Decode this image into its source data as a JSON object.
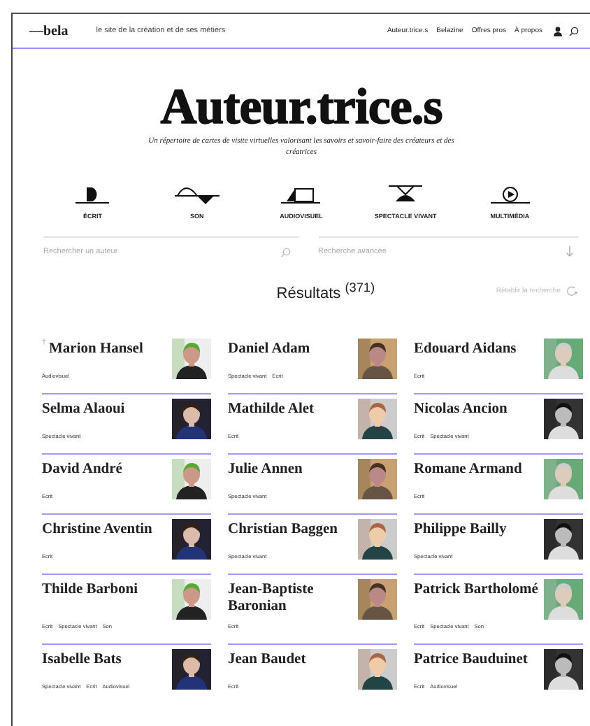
{
  "header": {
    "logo": "—bela",
    "tagline": "le site de la création et de ses métiers",
    "nav": [
      "Auteur.trice.s",
      "Belazine",
      "Offres pros",
      "À propos"
    ]
  },
  "title": "Auteur.trice.s",
  "subtitle": "Un répertoire de cartes de visite virtuelles valorisant les savoirs et savoir-faire des créateurs et des créatrices",
  "categories": [
    {
      "kind": "ecrit",
      "label": "ÉCRIT"
    },
    {
      "kind": "son",
      "label": "SON"
    },
    {
      "kind": "audiovisuel",
      "label": "AUDIOVISUEL"
    },
    {
      "kind": "spectacle",
      "label": "SPECTACLE VIVANT"
    },
    {
      "kind": "multimedia",
      "label": "MULTIMÉDIA"
    }
  ],
  "search": {
    "placeholder": "Rechercher un auteur"
  },
  "advanced": {
    "label": "Recherche avancée"
  },
  "results": {
    "label": "Résultats",
    "count": "(371)",
    "reset": "Rétablir la recherche"
  },
  "authors": [
    {
      "mark": "†",
      "name": "Marion Hansel",
      "tags": [
        "Audiovisuel"
      ]
    },
    {
      "name": "Daniel Adam",
      "tags": [
        "Spectacle vivant",
        "Ecrit"
      ]
    },
    {
      "name": "Edouard Aidans",
      "tags": [
        "Ecrit"
      ]
    },
    {
      "name": "Selma Alaoui",
      "tags": [
        "Spectacle vivant"
      ]
    },
    {
      "name": "Mathilde Alet",
      "tags": [
        "Ecrit"
      ]
    },
    {
      "name": "Nicolas Ancion",
      "tags": [
        "Ecrit",
        "Spectacle vivant"
      ]
    },
    {
      "name": "David André",
      "tags": [
        "Ecrit"
      ]
    },
    {
      "name": "Julie Annen",
      "tags": [
        "Spectacle vivant"
      ]
    },
    {
      "name": "Romane Armand",
      "tags": [
        "Ecrit"
      ]
    },
    {
      "name": "Christine Aventin",
      "tags": [
        "Ecrit"
      ]
    },
    {
      "name": "Christian Baggen",
      "tags": [
        "Spectacle vivant"
      ]
    },
    {
      "name": "Philippe Bailly",
      "tags": [
        "Spectacle vivant"
      ]
    },
    {
      "name": "Thilde Barboni",
      "tags": [
        "Ecrit",
        "Spectacle vivant",
        "Son"
      ]
    },
    {
      "name": "Jean-Baptiste Baronian",
      "tags": [
        "Ecrit"
      ]
    },
    {
      "name": "Patrick Bartholomé",
      "tags": [
        "Ecrit",
        "Spectacle vivant",
        "Son"
      ]
    },
    {
      "name": "Isabelle Bats",
      "tags": [
        "Spectacle vivant",
        "Ecrit",
        "Audiovisuel"
      ]
    },
    {
      "name": "Jean Baudet",
      "tags": [
        "Ecrit"
      ]
    },
    {
      "name": "Patrice Bauduinet",
      "tags": [
        "Ecrit",
        "Audiovisuel"
      ]
    }
  ]
}
